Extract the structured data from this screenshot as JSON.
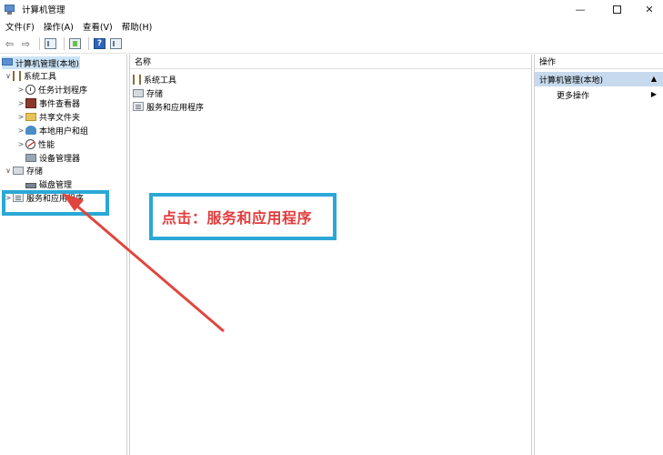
{
  "window": {
    "title": "计算机管理",
    "controls": {
      "minimize": "—",
      "close": "✕"
    }
  },
  "menu": {
    "items": [
      "文件(F)",
      "操作(A)",
      "查看(V)",
      "帮助(H)"
    ]
  },
  "toolbar": {
    "back_icon": "⇦",
    "forward_icon": "⇨",
    "help_label": "?"
  },
  "tree": {
    "root": "计算机管理(本地)",
    "items": [
      {
        "label": "系统工具",
        "chev": "∨"
      },
      {
        "label": "任务计划程序",
        "chev": ">"
      },
      {
        "label": "事件查看器",
        "chev": ">"
      },
      {
        "label": "共享文件夹",
        "chev": ">"
      },
      {
        "label": "本地用户和组",
        "chev": ">"
      },
      {
        "label": "性能",
        "chev": ">"
      },
      {
        "label": "设备管理器",
        "chev": ""
      },
      {
        "label": "存储",
        "chev": "∨"
      },
      {
        "label": "磁盘管理",
        "chev": ""
      },
      {
        "label": "服务和应用程序",
        "chev": ">"
      }
    ]
  },
  "content": {
    "column_header": "名称",
    "rows": [
      "系统工具",
      "存储",
      "服务和应用程序"
    ]
  },
  "actions": {
    "header": "操作",
    "section": "计算机管理(本地)",
    "section_arrow": "▲",
    "item": "更多操作",
    "item_arrow": "▶"
  },
  "annotation": {
    "callout": "点击：服务和应用程序",
    "box_color": "#2aa8d6",
    "text_color": "#e23b3b"
  }
}
